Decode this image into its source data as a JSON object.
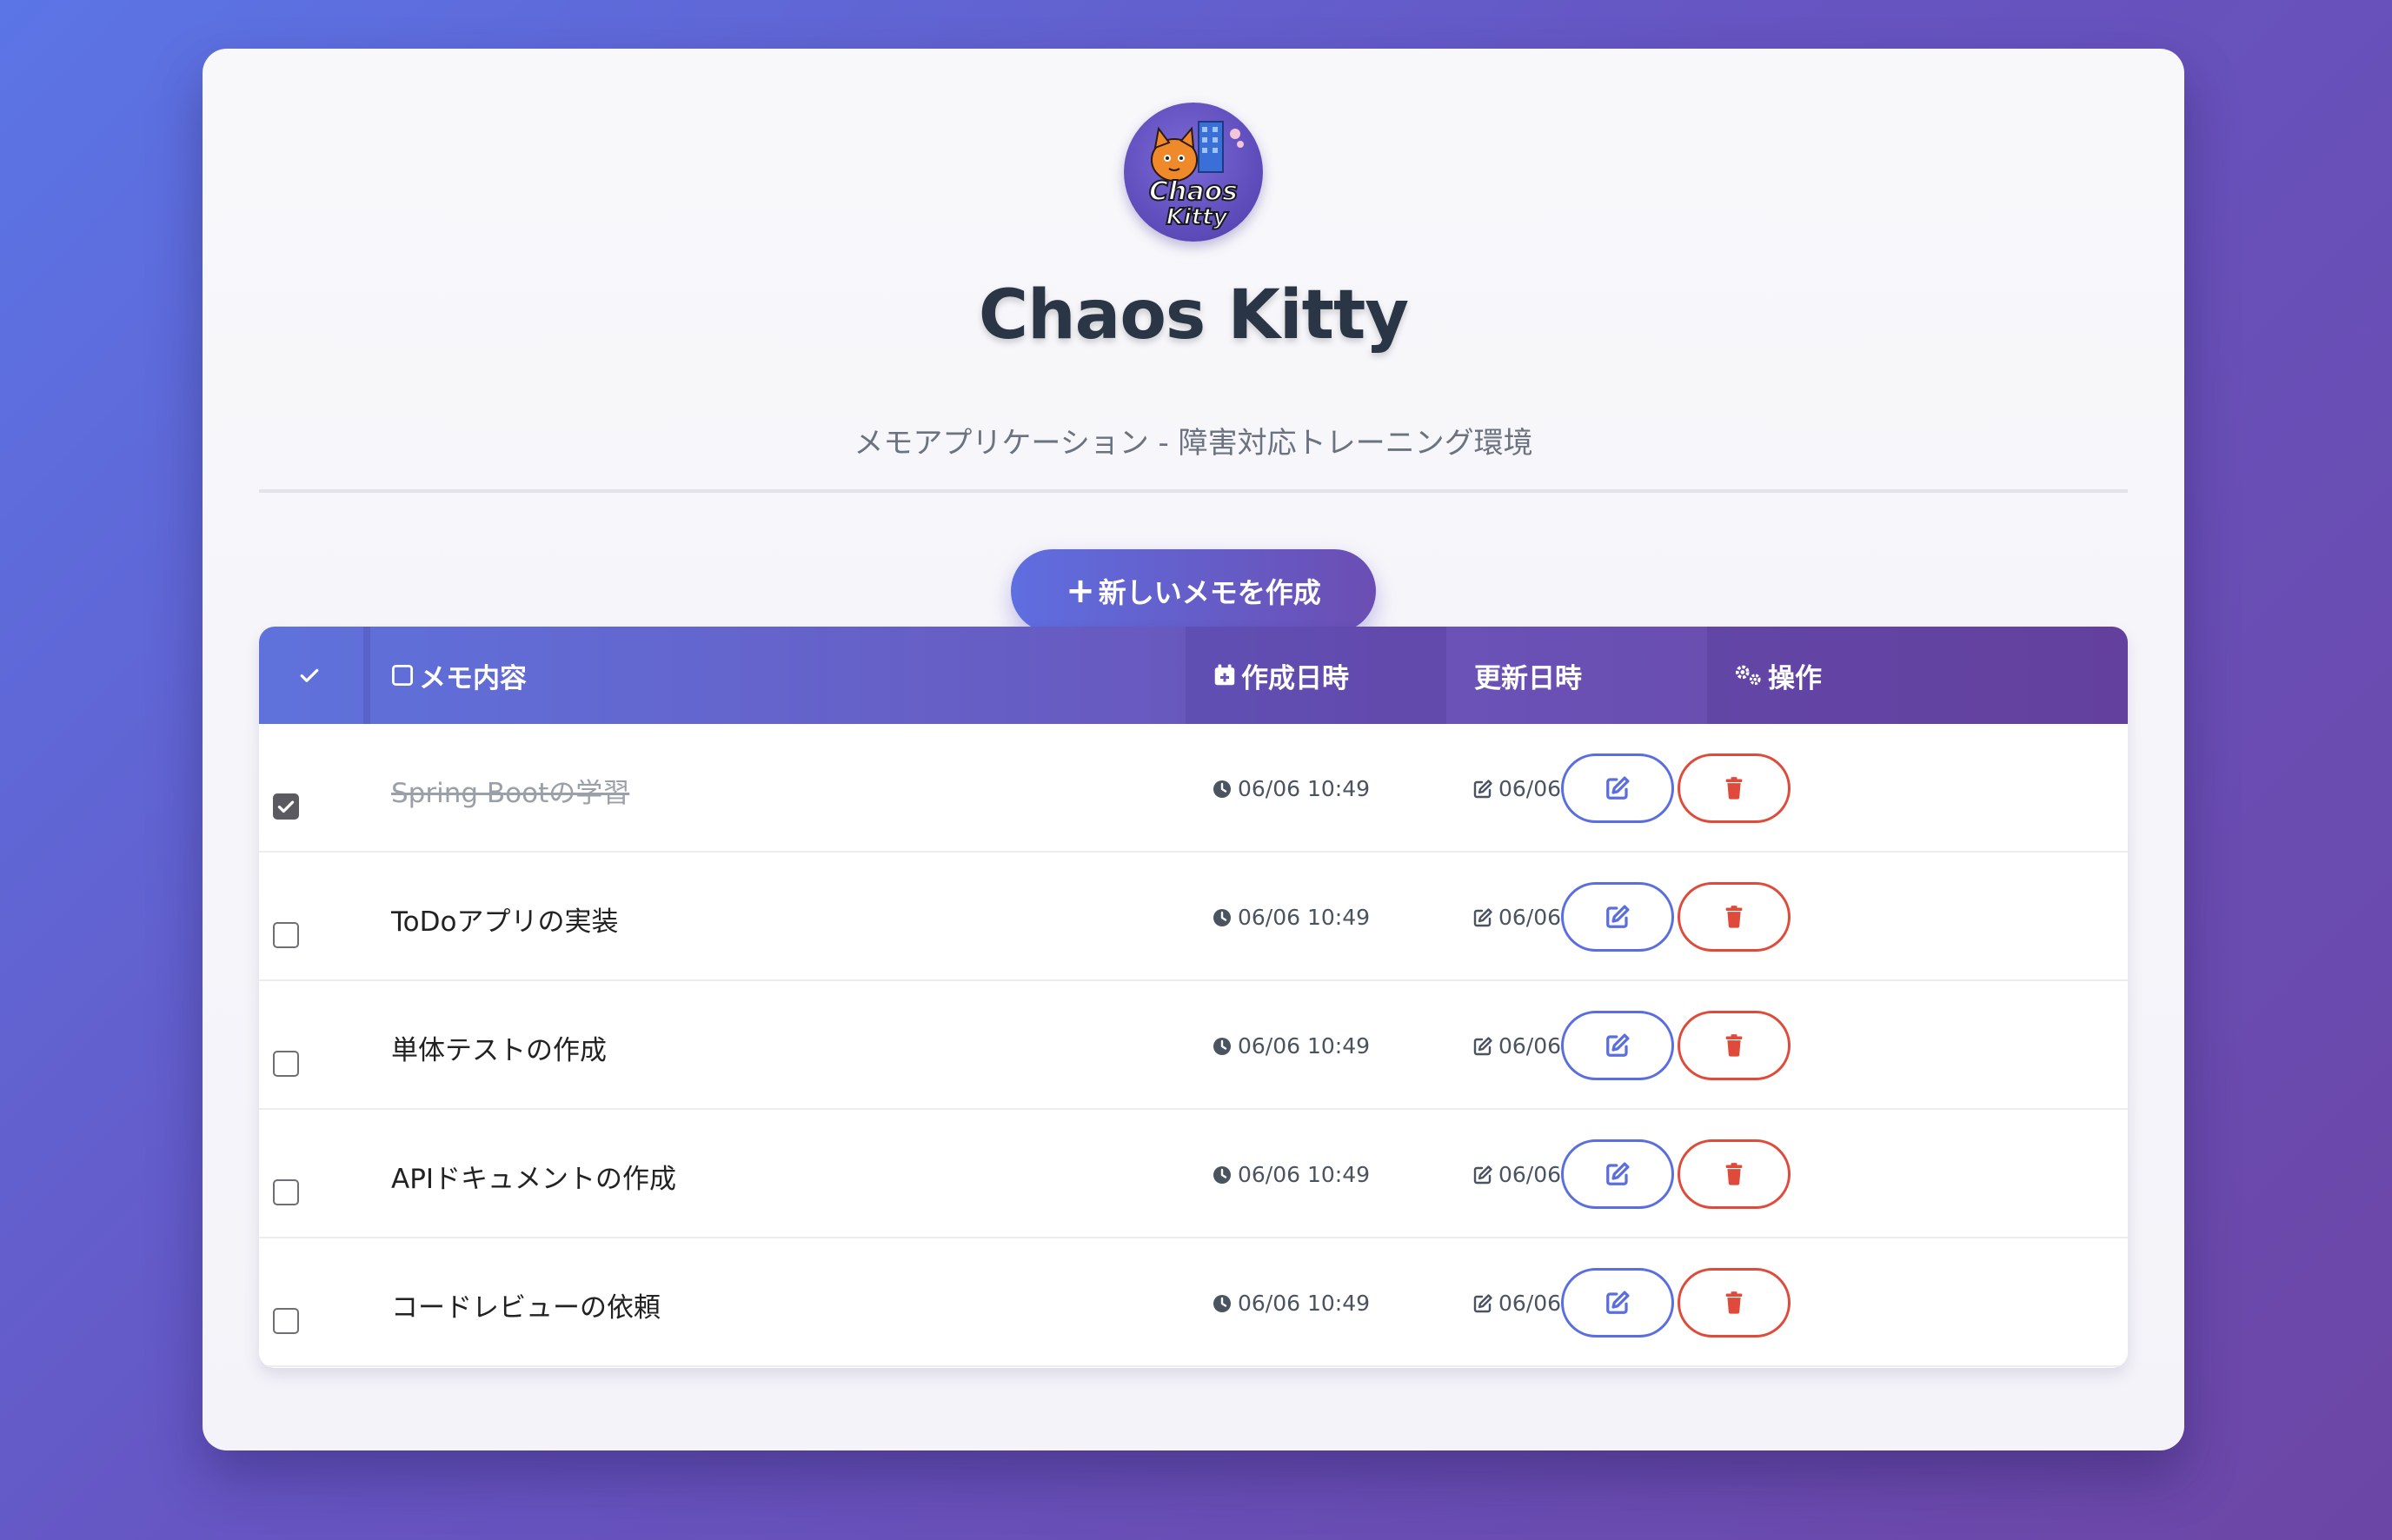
{
  "app": {
    "title": "Chaos Kitty",
    "subtitle": "メモアプリケーション - 障害対応トレーニング環境",
    "logo_text_top": "Chaos",
    "logo_text_bottom": "Kitty"
  },
  "actions": {
    "new_memo_icon": "plus-icon",
    "new_memo_label": "新しいメモを作成"
  },
  "table": {
    "headers": {
      "select_icon": "check-icon",
      "content_icon": "memo-icon",
      "content": "メモ内容",
      "created_icon": "calendar-plus-icon",
      "created": "作成日時",
      "updated": "更新日時",
      "actions_icon": "gears-icon",
      "actions": "操作"
    },
    "rows": [
      {
        "checked": true,
        "content": "Spring Bootの学習",
        "created": "06/06 10:49",
        "updated": "06/06 10:49"
      },
      {
        "checked": false,
        "content": "ToDoアプリの実装",
        "created": "06/06 10:49",
        "updated": "06/06 10:49"
      },
      {
        "checked": false,
        "content": "単体テストの作成",
        "created": "06/06 10:49",
        "updated": "06/06 10:49"
      },
      {
        "checked": false,
        "content": "APIドキュメントの作成",
        "created": "06/06 10:49",
        "updated": "06/06 10:49"
      },
      {
        "checked": false,
        "content": "コードレビューの依頼",
        "created": "06/06 10:49",
        "updated": "06/06 10:49"
      }
    ]
  },
  "colors": {
    "accent": "#5f6ee0",
    "accent_dark": "#6b47a6",
    "danger": "#e04a3a",
    "title": "#2a3645"
  }
}
